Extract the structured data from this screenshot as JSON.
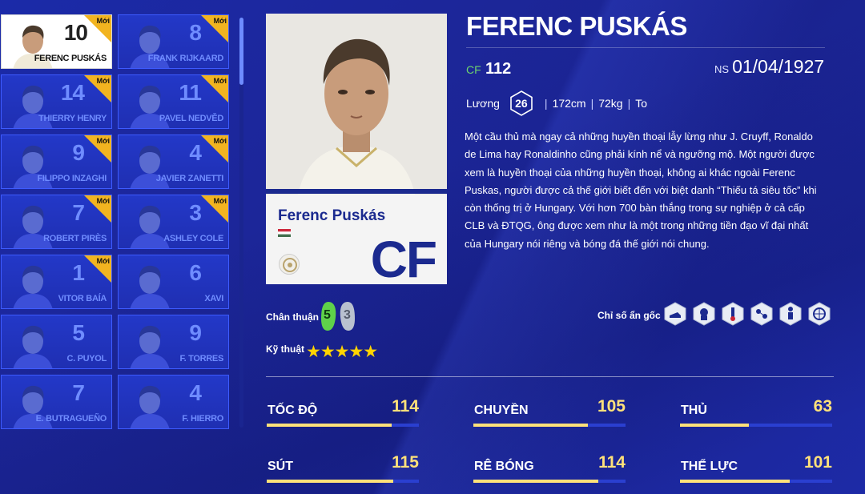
{
  "new_badge_label": "Mới",
  "player_list": [
    {
      "rank": "10",
      "name": "FERENC PUSKÁS",
      "is_new": true,
      "selected": true
    },
    {
      "rank": "8",
      "name": "FRANK RIJKAARD",
      "is_new": true,
      "selected": false
    },
    {
      "rank": "14",
      "name": "THIERRY HENRY",
      "is_new": true,
      "selected": false
    },
    {
      "rank": "11",
      "name": "PAVEL NEDVĚD",
      "is_new": true,
      "selected": false
    },
    {
      "rank": "9",
      "name": "FILIPPO INZAGHI",
      "is_new": true,
      "selected": false
    },
    {
      "rank": "4",
      "name": "JAVIER ZANETTI",
      "is_new": true,
      "selected": false
    },
    {
      "rank": "7",
      "name": "ROBERT PIRÈS",
      "is_new": true,
      "selected": false
    },
    {
      "rank": "3",
      "name": "ASHLEY COLE",
      "is_new": true,
      "selected": false
    },
    {
      "rank": "1",
      "name": "VITOR BAÍA",
      "is_new": true,
      "selected": false
    },
    {
      "rank": "6",
      "name": "XAVI",
      "is_new": false,
      "selected": false
    },
    {
      "rank": "5",
      "name": "C. PUYOL",
      "is_new": false,
      "selected": false
    },
    {
      "rank": "9",
      "name": "F. TORRES",
      "is_new": false,
      "selected": false
    },
    {
      "rank": "7",
      "name": "E. BUTRAGUEÑO",
      "is_new": false,
      "selected": false
    },
    {
      "rank": "4",
      "name": "F. HIERRO",
      "is_new": false,
      "selected": false
    }
  ],
  "player": {
    "title": "FERENC PUSKÁS",
    "card_name": "Ferenc Puskás",
    "card_position": "CF",
    "position": "CF",
    "ovr": "112",
    "birth_label": "NS",
    "birth_date": "01/04/1927",
    "salary_label": "Lương",
    "salary": "26",
    "height": "172cm",
    "weight": "72kg",
    "build": "To",
    "description": "Một cầu thủ mà ngay cả những huyền thoại lẫy lừng như J. Cruyff, Ronaldo de Lima hay Ronaldinho cũng phải kính nể và ngưỡng mộ. Một người được xem là huyền thoại của những huyền thoại, không ai khác ngoài Ferenc Puskas, người được cả thế giới biết đến với biệt danh “Thiếu tá siêu tốc” khi còn thống trị ở Hungary. Với hơn 700 bàn thắng trong sự nghiệp ở cả cấp CLB và ĐTQG, ông được xem như là một trong những tiền đạo vĩ đại nhất của Hungary nói riêng và bóng đá thế giới nói chung."
  },
  "footedness": {
    "label": "Chân thuận",
    "left": "5",
    "right": "3"
  },
  "skill": {
    "label": "Kỹ thuật",
    "stars": 5,
    "stars_text": "★★★★★"
  },
  "hidden_traits": {
    "label": "Chỉ số ẩn gốc",
    "icons": [
      "boot-icon",
      "head-icon",
      "trophy-icon",
      "ball-network-icon",
      "player-icon",
      "ball-icon"
    ]
  },
  "stats": [
    {
      "name": "TỐC ĐỘ",
      "value": "114",
      "fill": 0.82
    },
    {
      "name": "CHUYỀN",
      "value": "105",
      "fill": 0.75
    },
    {
      "name": "THỦ",
      "value": "63",
      "fill": 0.45
    },
    {
      "name": "SÚT",
      "value": "115",
      "fill": 0.83
    },
    {
      "name": "RÊ BÓNG",
      "value": "114",
      "fill": 0.82
    },
    {
      "name": "THỂ LỰC",
      "value": "101",
      "fill": 0.72
    }
  ],
  "colors": {
    "accent": "#ffe17a",
    "badge": "#f2b420",
    "foot_left": "#5fd14a",
    "foot_right": "#b9c1cf",
    "star": "#ffd400"
  }
}
